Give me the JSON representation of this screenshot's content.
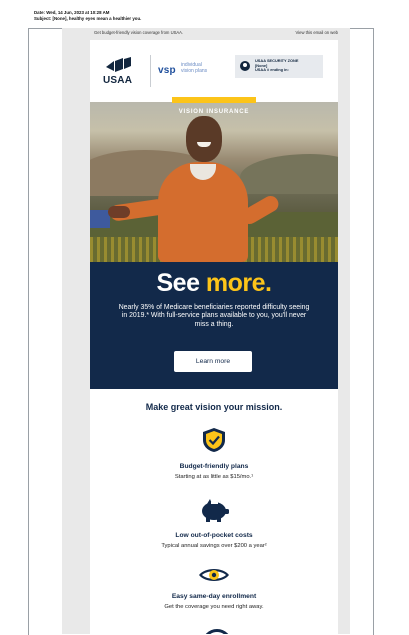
{
  "meta": {
    "date": "Date: Wed, 14 Jun, 2023 at 10:28 AM",
    "subject": "Subject: [None], healthy eyes mean a healthier you."
  },
  "preheader": {
    "left": "Get budget-friendly vision coverage from USAA.",
    "right": "View this email on web"
  },
  "brand": {
    "usaa": "USAA",
    "vsp": "vsp",
    "vsp_sub": "individual\nvision plans",
    "security_title": "USAA SECURITY ZONE",
    "security_name": "[None]",
    "security_account": "USAA # ending in:"
  },
  "hero_label": "VISION INSURANCE",
  "promo": {
    "headline_a": "See ",
    "headline_b": "more.",
    "body": "Nearly 35% of Medicare beneficiaries reported difficulty seeing in 2019.* With full-service plans available to you, you'll never miss a thing.",
    "cta": "Learn more"
  },
  "mission_title": "Make great vision your mission.",
  "features": [
    {
      "title": "Budget-friendly plans",
      "desc": "Starting at as little as $15/mo.¹",
      "icon": "shield-check-icon"
    },
    {
      "title": "Low out-of-pocket costs",
      "desc": "Typical annual savings over $200 a year²",
      "icon": "piggy-bank-icon"
    },
    {
      "title": "Easy same-day enrollment",
      "desc": "Get the coverage you need right away.",
      "icon": "eye-icon"
    }
  ],
  "colors": {
    "navy": "#12294a",
    "gold": "#fcc419",
    "vsp_blue": "#1f4f9c"
  }
}
